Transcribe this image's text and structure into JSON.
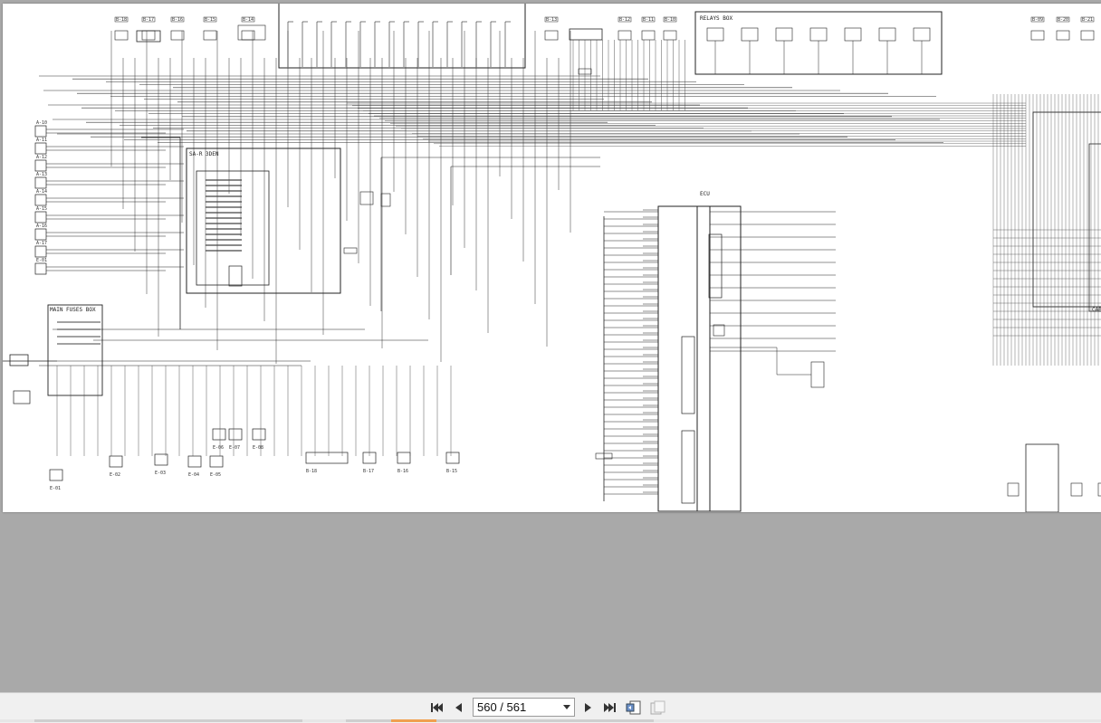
{
  "viewer": {
    "page_indicator": "560 / 561",
    "toolbar": {
      "first_page": "first-page-icon",
      "prev_page": "prev-page-icon",
      "next_page": "next-page-icon",
      "last_page": "last-page-icon",
      "page_select": "chevron-down-icon",
      "fit_width": "fit-width-icon",
      "fit_page": "fit-page-icon"
    },
    "colors": {
      "background": "#a9a9a9",
      "toolbar": "#f0f0f0",
      "page": "#ffffff",
      "accent": "#f0a050"
    }
  },
  "schematic": {
    "box_labels": {
      "relays_box": "RELAYS BOX",
      "sa_r_box": "SA-R 3DEN",
      "main_fuses_box": "MAIN FUSES BOX",
      "cab_label": "CAB",
      "ecu_label": "ECU"
    },
    "connectors": [
      "B-18",
      "B-17",
      "B-16",
      "B-15",
      "B-14",
      "B-13",
      "B-12",
      "B-11",
      "B-10",
      "B-09",
      "B-20",
      "B-21",
      "B-22",
      "B-23",
      "B-24",
      "B-25",
      "B-26",
      "B-27",
      "A-10",
      "A-11",
      "A-12",
      "A-13",
      "A-14",
      "A-15",
      "A-16",
      "A-17",
      "E-01",
      "E-02",
      "E-03",
      "E-04",
      "E-05",
      "E-06",
      "E-07",
      "E-08"
    ]
  }
}
